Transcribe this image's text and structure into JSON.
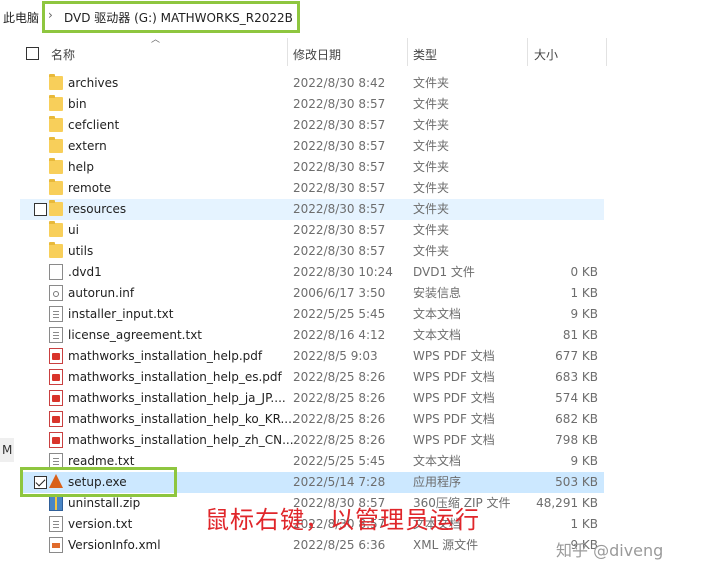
{
  "breadcrumb": {
    "root": "此电脑",
    "separator": "›",
    "drive": "DVD 驱动器 (G:) MATHWORKS_R2022B"
  },
  "columns": {
    "name": "名称",
    "date": "修改日期",
    "type": "类型",
    "size": "大小"
  },
  "side_stub": "M",
  "rows": [
    {
      "name": "archives",
      "date": "2022/8/30 8:42",
      "type": "文件夹",
      "size": "",
      "icon": "folder-icon"
    },
    {
      "name": "bin",
      "date": "2022/8/30 8:57",
      "type": "文件夹",
      "size": "",
      "icon": "folder-icon"
    },
    {
      "name": "cefclient",
      "date": "2022/8/30 8:57",
      "type": "文件夹",
      "size": "",
      "icon": "folder-icon"
    },
    {
      "name": "extern",
      "date": "2022/8/30 8:57",
      "type": "文件夹",
      "size": "",
      "icon": "folder-icon"
    },
    {
      "name": "help",
      "date": "2022/8/30 8:57",
      "type": "文件夹",
      "size": "",
      "icon": "folder-icon"
    },
    {
      "name": "remote",
      "date": "2022/8/30 8:57",
      "type": "文件夹",
      "size": "",
      "icon": "folder-icon"
    },
    {
      "name": "resources",
      "date": "2022/8/30 8:57",
      "type": "文件夹",
      "size": "",
      "icon": "folder-icon"
    },
    {
      "name": "ui",
      "date": "2022/8/30 8:57",
      "type": "文件夹",
      "size": "",
      "icon": "folder-icon"
    },
    {
      "name": "utils",
      "date": "2022/8/30 8:57",
      "type": "文件夹",
      "size": "",
      "icon": "folder-icon"
    },
    {
      "name": ".dvd1",
      "date": "2022/8/30 10:24",
      "type": "DVD1 文件",
      "size": "0 KB",
      "icon": "file-icon"
    },
    {
      "name": "autorun.inf",
      "date": "2006/6/17 3:50",
      "type": "安装信息",
      "size": "1 KB",
      "icon": "settings-file-icon"
    },
    {
      "name": "installer_input.txt",
      "date": "2022/5/25 5:45",
      "type": "文本文档",
      "size": "9 KB",
      "icon": "text-file-icon"
    },
    {
      "name": "license_agreement.txt",
      "date": "2022/8/16 4:12",
      "type": "文本文档",
      "size": "81 KB",
      "icon": "text-file-icon"
    },
    {
      "name": "mathworks_installation_help.pdf",
      "date": "2022/8/5 9:03",
      "type": "WPS PDF 文档",
      "size": "677 KB",
      "icon": "pdf-icon"
    },
    {
      "name": "mathworks_installation_help_es.pdf",
      "date": "2022/8/25 8:26",
      "type": "WPS PDF 文档",
      "size": "683 KB",
      "icon": "pdf-icon"
    },
    {
      "name": "mathworks_installation_help_ja_JP....",
      "date": "2022/8/25 8:26",
      "type": "WPS PDF 文档",
      "size": "574 KB",
      "icon": "pdf-icon"
    },
    {
      "name": "mathworks_installation_help_ko_KR....",
      "date": "2022/8/25 8:26",
      "type": "WPS PDF 文档",
      "size": "682 KB",
      "icon": "pdf-icon"
    },
    {
      "name": "mathworks_installation_help_zh_CN....",
      "date": "2022/8/25 8:26",
      "type": "WPS PDF 文档",
      "size": "798 KB",
      "icon": "pdf-icon"
    },
    {
      "name": "readme.txt",
      "date": "2022/5/25 5:45",
      "type": "文本文档",
      "size": "9 KB",
      "icon": "text-file-icon"
    },
    {
      "name": "setup.exe",
      "date": "2022/5/14 7:28",
      "type": "应用程序",
      "size": "503 KB",
      "icon": "matlab-setup-icon"
    },
    {
      "name": "uninstall.zip",
      "date": "2022/8/30 8:57",
      "type": "360压缩 ZIP 文件",
      "size": "48,291 KB",
      "icon": "zip-icon"
    },
    {
      "name": "version.txt",
      "date": "2022/8/30 8:57",
      "type": "文本文档",
      "size": "1 KB",
      "icon": "text-file-icon"
    },
    {
      "name": "VersionInfo.xml",
      "date": "2022/8/25 6:36",
      "type": "XML 源文件",
      "size": "9 KB",
      "icon": "xml-file-icon"
    }
  ],
  "annotation": "鼠标右键，以管理员运行",
  "watermark": "知乎 @diveng",
  "colors": {
    "highlight_box": "#8ec63f",
    "annotation": "#e0262a",
    "row_hover": "#e5f3ff",
    "row_selected": "#cce8ff"
  }
}
